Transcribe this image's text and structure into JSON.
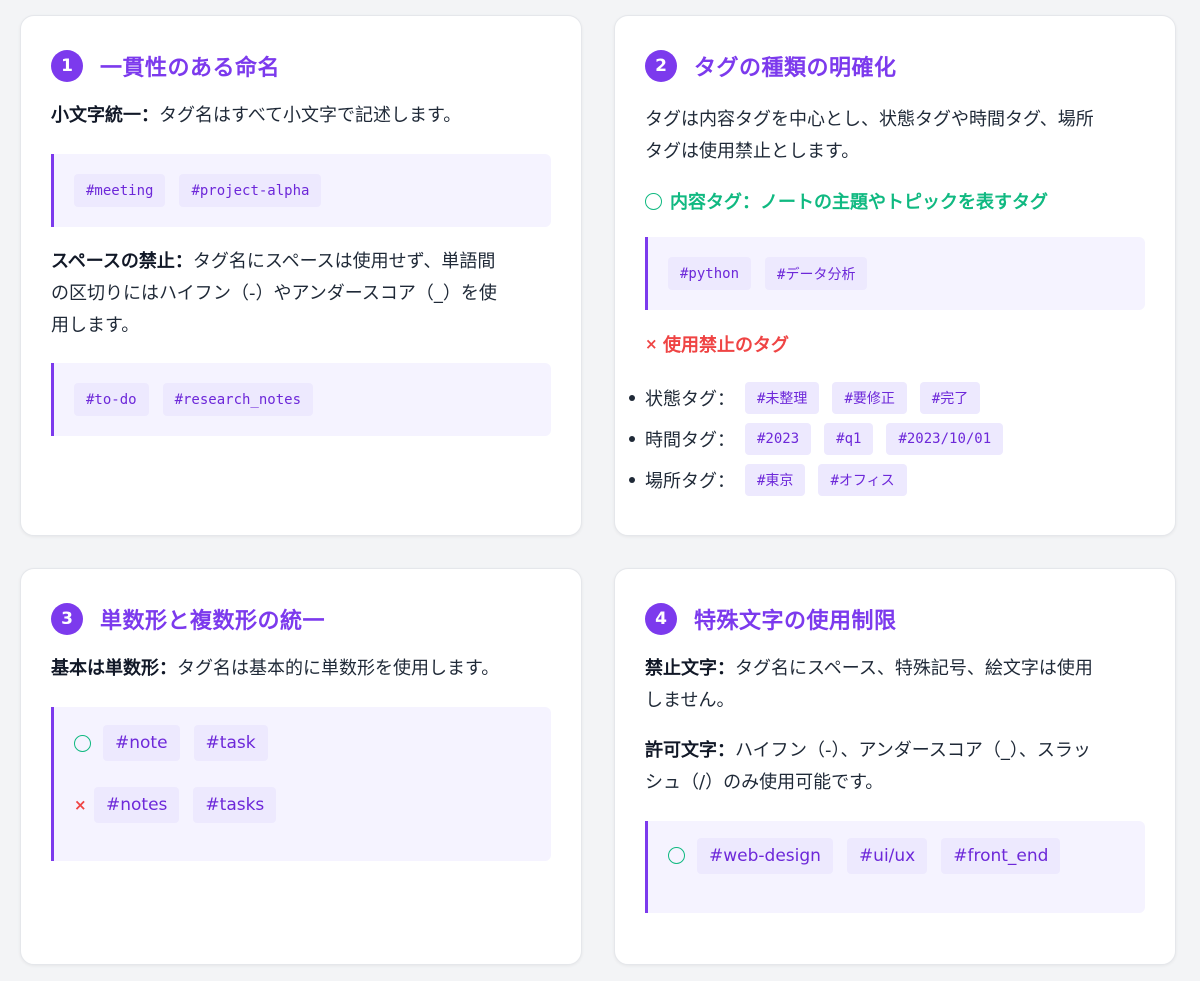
{
  "cards": [
    {
      "number": "1",
      "title": "一貫性のある命名",
      "rules": [
        {
          "label": "小文字統一：",
          "text": "タグ名はすべて小文字で記述します。",
          "tags": [
            "#meeting",
            "#project-alpha"
          ]
        },
        {
          "label": "スペースの禁止：",
          "text": "タグ名にスペースは使用せず、単語間の区切りにはハイフン（-）やアンダースコア（_）を使用します。",
          "text_lines": [
            "タグ名にスペースは使用せず、単語間",
            "の区切りにはハイフン（-）やアンダースコア（_）を使",
            "用します。"
          ],
          "tags": [
            "#to-do",
            "#research_notes"
          ]
        }
      ]
    },
    {
      "number": "2",
      "title": "タグの種類の明確化",
      "intro": "タグは内容タグを中心とし、状態タグや時間タグ、場所タグは使用禁止とします。",
      "intro_lines": [
        "タグは内容タグを中心とし、状態タグや時間タグ、場所",
        "タグは使用禁止とします。"
      ],
      "allowed": {
        "icon": "circle-ok-icon",
        "label": "内容タグ：ノートの主題やトピックを表すタグ",
        "tags": [
          "#python",
          "#データ分析"
        ]
      },
      "forbidden": {
        "icon": "×",
        "label": "使用禁止のタグ",
        "items": [
          {
            "label": "状態タグ：",
            "tags": [
              "#未整理",
              "#要修正",
              "#完了"
            ]
          },
          {
            "label": "時間タグ：",
            "tags": [
              "#2023",
              "#q1",
              "#2023/10/01"
            ]
          },
          {
            "label": "場所タグ：",
            "tags": [
              "#東京",
              "#オフィス"
            ]
          }
        ]
      }
    },
    {
      "number": "3",
      "title": "単数形と複数形の統一",
      "label": "基本は単数形：",
      "text": "タグ名は基本的に単数形を使用します。",
      "good": {
        "icon": "circle-ok-icon",
        "tags": [
          "#note",
          "#task"
        ]
      },
      "bad": {
        "icon": "×",
        "tags": [
          "#notes",
          "#tasks"
        ]
      }
    },
    {
      "number": "4",
      "title": "特殊文字の使用制限",
      "rules": [
        {
          "label": "禁止文字：",
          "text": "タグ名にスペース、特殊記号、絵文字は使用しません。",
          "text_lines": [
            "タグ名にスペース、特殊記号、絵文字は使用",
            "しません。"
          ]
        },
        {
          "label": "許可文字：",
          "text": "ハイフン（-）、アンダースコア（_）、スラッシュ（/）のみ使用可能です。",
          "text_lines": [
            "ハイフン（-）、アンダースコア（_）、スラッ",
            "シュ（/）のみ使用可能です。"
          ]
        }
      ],
      "good": {
        "icon": "circle-ok-icon",
        "tags": [
          "#web-design",
          "#ui/ux",
          "#front_end"
        ]
      }
    }
  ],
  "colors": {
    "accent": "#7c3aed",
    "ok": "#10b981",
    "ng": "#ef4444",
    "tag_bg": "#ede9fe",
    "box_bg": "#f5f3ff"
  }
}
